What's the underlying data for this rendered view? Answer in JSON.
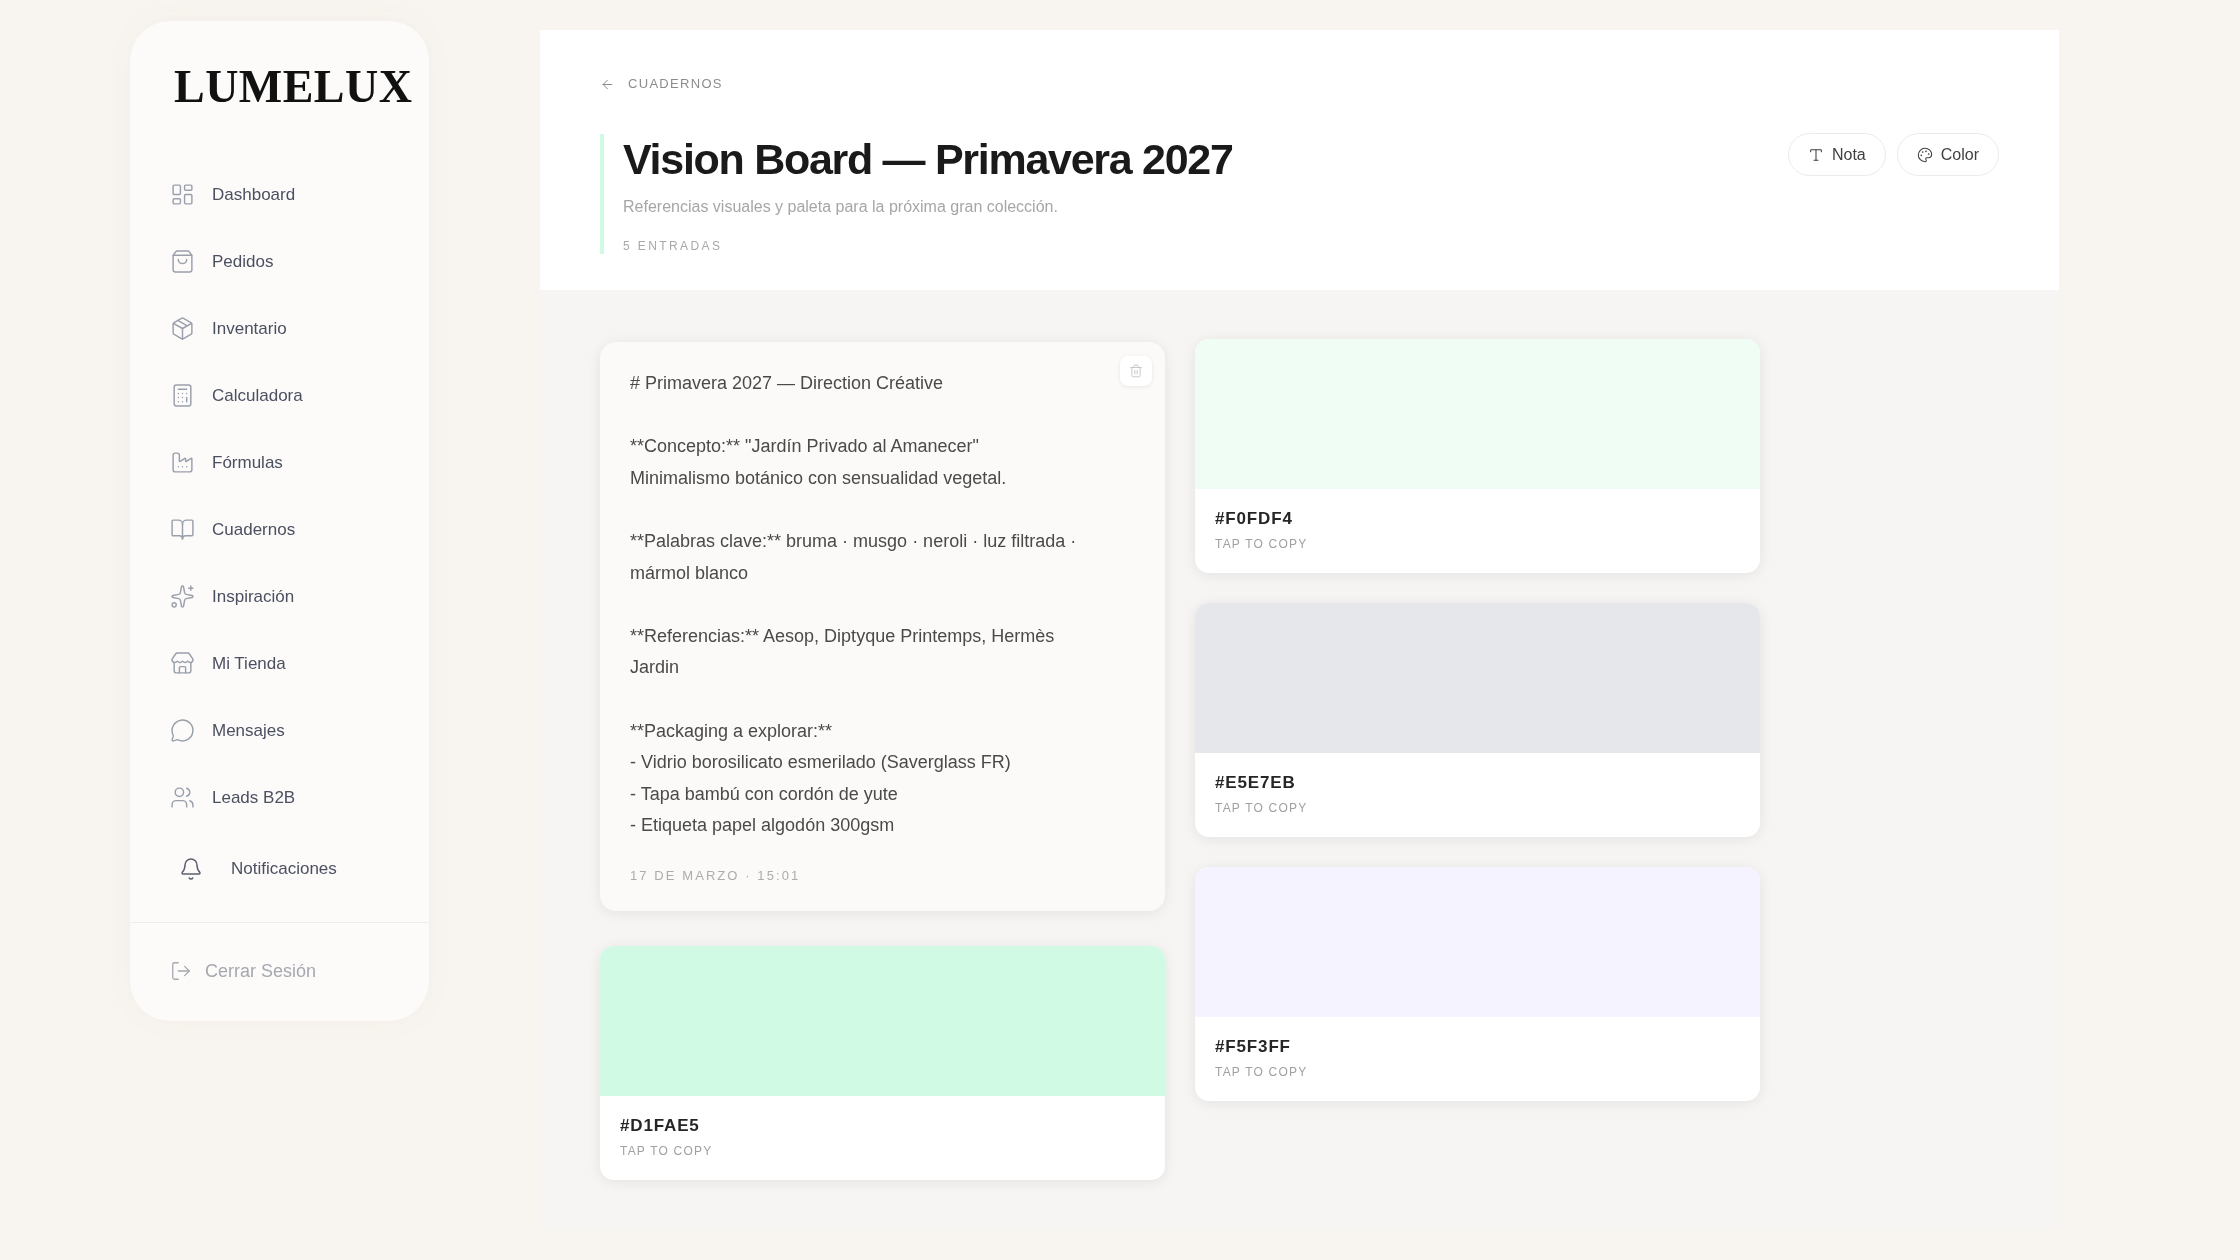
{
  "sidebar": {
    "logo": "LUMELUX",
    "nav_items": [
      {
        "label": "Dashboard",
        "kind": "link"
      },
      {
        "label": "Pedidos",
        "kind": "link"
      },
      {
        "label": "Inventario",
        "kind": "link"
      },
      {
        "label": "Calculadora",
        "kind": "link"
      },
      {
        "label": "Fórmulas",
        "kind": "link"
      },
      {
        "label": "Cuadernos",
        "kind": "link"
      },
      {
        "label": "Inspiración",
        "kind": "link"
      },
      {
        "label": "Mi Tienda",
        "kind": "link"
      },
      {
        "label": "Mensajes",
        "kind": "link"
      },
      {
        "label": "Leads B2B",
        "kind": "link"
      },
      {
        "label": "Notificaciones",
        "kind": "button"
      }
    ],
    "logout": "Cerrar Sesión"
  },
  "header": {
    "breadcrumb": "CUADERNOS",
    "title": "Vision Board — Primavera 2027",
    "subtitle": "Referencias visuales y paleta para la próxima gran colección.",
    "count": "5 ENTRADAS",
    "actions": [
      {
        "label": "Nota"
      },
      {
        "label": "Color"
      }
    ]
  },
  "board": {
    "columns": [
      {
        "entries": [
          {
            "kind": "note",
            "blocks": [
              [
                "# Primavera 2027 — Direction Créative"
              ],
              [
                "**Concepto:** \"Jardín Privado al Amanecer\"",
                "Minimalismo botánico con sensualidad vegetal."
              ],
              [
                "**Palabras clave:** bruma · musgo · neroli · luz filtrada · mármol blanco"
              ],
              [
                "**Referencias:** Aesop, Diptyque Printemps, Hermès Jardin"
              ],
              [
                "**Packaging a explorar:**",
                "- Vidrio borosilicato esmerilado (Saverglass FR)",
                "- Tapa bambú con cordón de yute",
                "- Etiqueta papel algodón 300gsm"
              ]
            ],
            "timestamp": "17 DE MARZO · 15:01"
          },
          {
            "kind": "color",
            "color": "#d1fae5",
            "hex": "#D1FAE5",
            "hint": "TAP TO COPY"
          }
        ]
      },
      {
        "entries": [
          {
            "kind": "color",
            "color": "#f0fdf4",
            "hex": "#F0FDF4",
            "hint": "TAP TO COPY"
          },
          {
            "kind": "color",
            "color": "#e5e7eb",
            "hex": "#E5E7EB",
            "hint": "TAP TO COPY"
          },
          {
            "kind": "color",
            "color": "#f5f3ff",
            "hex": "#F5F3FF",
            "hint": "TAP TO COPY"
          }
        ]
      }
    ]
  }
}
